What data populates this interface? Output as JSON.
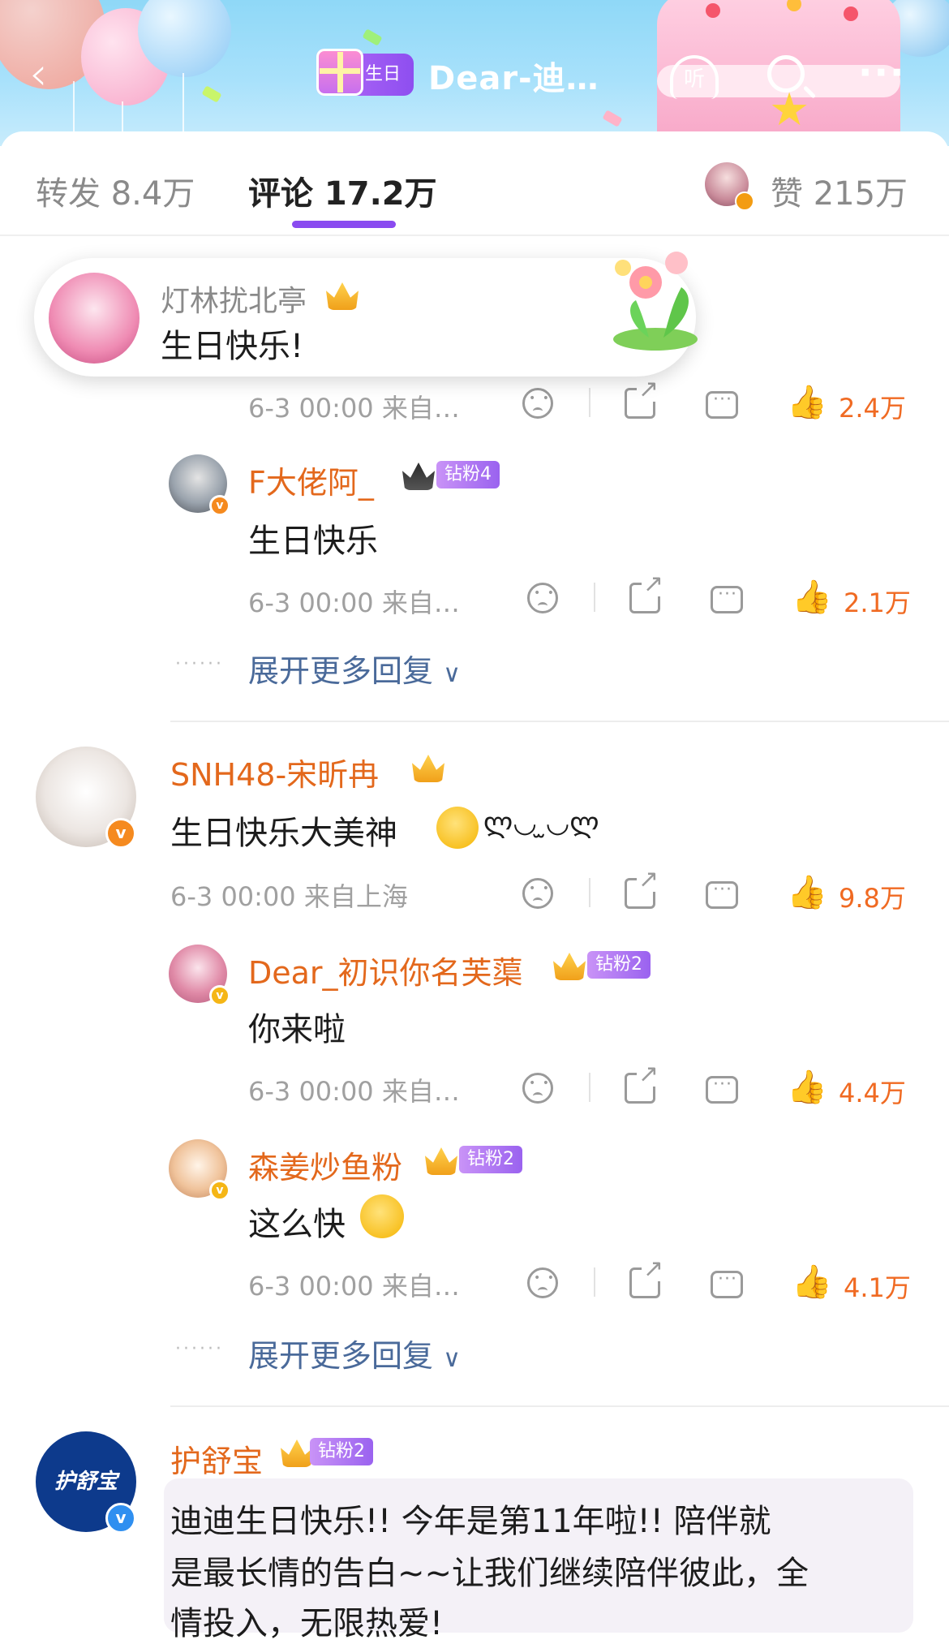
{
  "header": {
    "back_icon": "chevron-left-icon",
    "badge_label": "生日",
    "title": "Dear-迪…",
    "listen_label": "听"
  },
  "tabs": {
    "repost": "转发 8.4万",
    "comments": "评论 17.2万",
    "likes": "赞 215万"
  },
  "toast": {
    "username": "灯林扰北亭",
    "text": "生日快乐!"
  },
  "thread1": {
    "meta": "6-3 00:00 来自…",
    "likes": "2.4万",
    "reply1": {
      "username": "F大佬阿_",
      "fan_tag": "钻粉4",
      "text": "生日快乐",
      "meta": "6-3 00:00 来自…",
      "likes": "2.1万"
    },
    "expand": "展开更多回复"
  },
  "thread2": {
    "username": "SNH48-宋昕冉",
    "text": "生日快乐大美神",
    "kaomoji": "ლ◡ ̫◡ლ",
    "meta": "6-3 00:00 来自上海",
    "likes": "9.8万",
    "reply1": {
      "username": "Dear_初识你名芙蕖",
      "fan_tag": "钻粉2",
      "text": "你来啦",
      "meta": "6-3 00:00 来自…",
      "likes": "4.4万"
    },
    "reply2": {
      "username": "森姜炒鱼粉",
      "fan_tag": "钻粉2",
      "text": "这么快",
      "meta": "6-3 00:00 来自…",
      "likes": "4.1万"
    },
    "expand": "展开更多回复"
  },
  "thread3": {
    "username": "护舒宝",
    "fan_tag": "钻粉2",
    "avatar_text": "护舒宝",
    "line1": "迪迪生日快乐!! 今年是第11年啦!! 陪伴就",
    "line2": "是最长情的告白~~让我们继续陪伴彼此，全",
    "line3": "情投入，无限热爱!"
  },
  "colors": {
    "accent_purple": "#8a4bf0",
    "username_orange": "#e3681c",
    "like_orange": "#f06a22",
    "expand_blue": "#4a6a9a"
  }
}
